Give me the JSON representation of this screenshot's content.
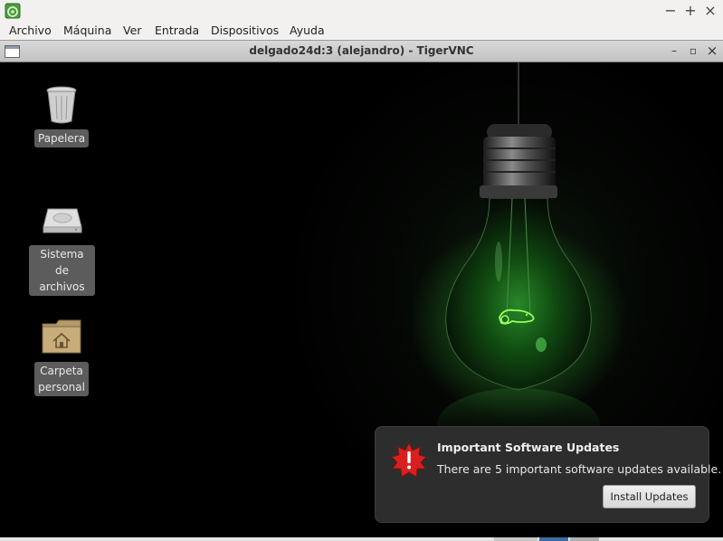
{
  "outer_window": {
    "app_icon": "virtualbox-app-icon",
    "minimize_symbol": "−",
    "maximize_symbol": "+",
    "close_symbol": "×"
  },
  "menubar": {
    "items": [
      "Archivo",
      "Máquina",
      "Ver",
      "Entrada",
      "Dispositivos",
      "Ayuda"
    ]
  },
  "vnc_window": {
    "title": "delgado24d:3 (alejandro) - TigerVNC",
    "minimize_symbol": "–",
    "maximize_symbol": "▫",
    "close_symbol": "×"
  },
  "desktop": {
    "wallpaper": "green-lightbulb-chameleon",
    "icons": [
      {
        "label": "Papelera",
        "icon": "trash-icon"
      },
      {
        "label": "Sistema de archivos",
        "icon": "hard-drive-icon"
      },
      {
        "label": "Carpeta personal",
        "icon": "home-folder-icon"
      }
    ]
  },
  "notification": {
    "icon": "warning-star-icon",
    "title": "Important Software Updates",
    "body": "There are 5 important software updates available.",
    "button_label": "Install Updates"
  },
  "colors": {
    "bulb_glow": "#2ecc2e",
    "notification_bg": "#2d2d2d",
    "warning_red": "#d92020"
  }
}
